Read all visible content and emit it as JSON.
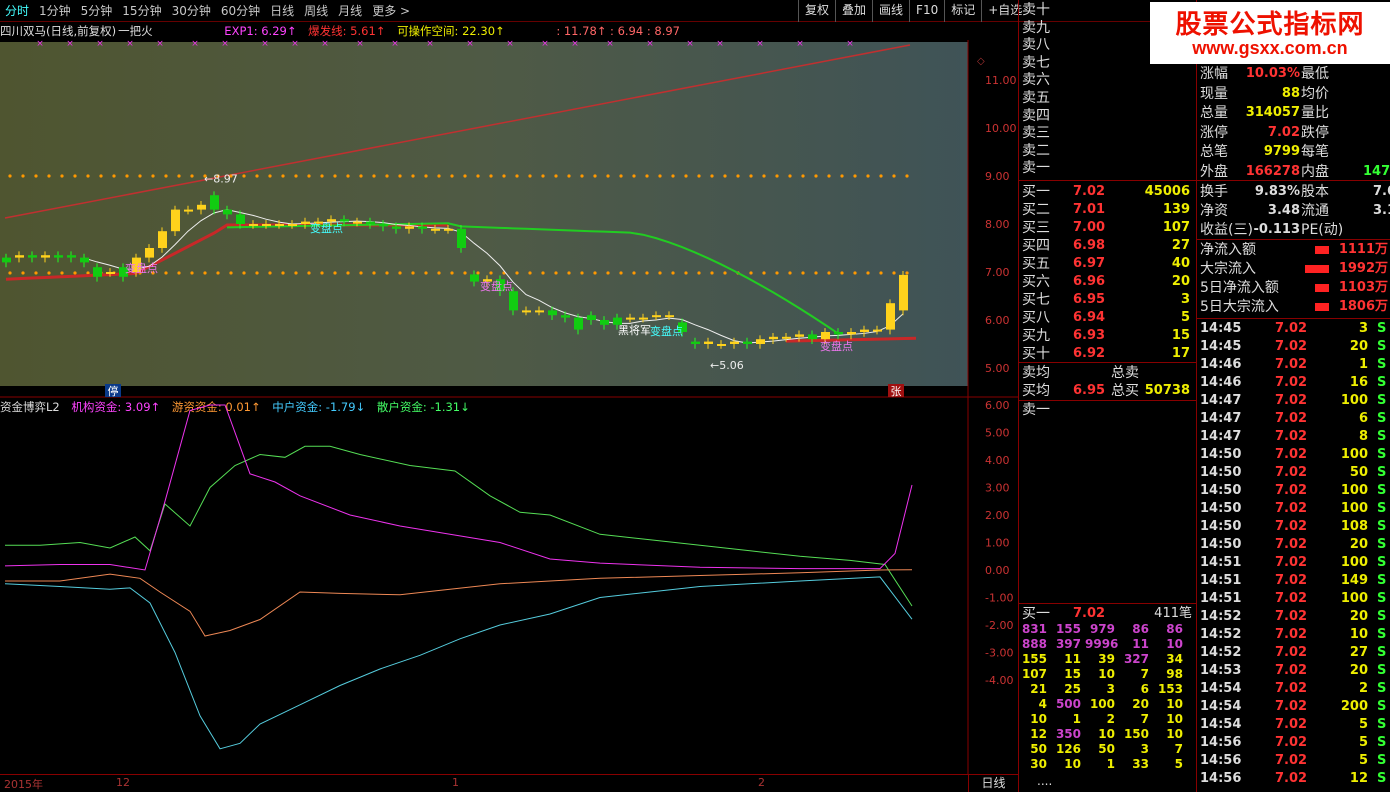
{
  "top_tabs": [
    "分时",
    "1分钟",
    "5分钟",
    "15分钟",
    "30分钟",
    "60分钟",
    "日线",
    "周线",
    "月线",
    "更多 >"
  ],
  "tool_buttons": [
    "复权",
    "叠加",
    "画线",
    "F10",
    "标记",
    "+自选"
  ],
  "watermark": {
    "line1": "股票公式指标网",
    "line2": "www.gsxx.com.cn"
  },
  "main_chart": {
    "stock": "四川双马(日线,前复权)",
    "indicator": "一把火",
    "exp1": "EXP1: 6.29↑",
    "baofa": "爆发线: 5.61↑",
    "kecaozuo": "可操作空间: 22.30↑",
    "vals": ": 11.78↑  : 6.94 : 8.97",
    "y_labels": [
      "11.00",
      "10.00",
      "9.00",
      "8.00",
      "7.00",
      "6.00",
      "5.00"
    ],
    "annotations": {
      "high": "8.97",
      "low": "5.06",
      "labels": [
        "变盘点",
        "变盘点",
        "变盘点",
        "变盘点",
        "变盘点",
        "黑将军"
      ]
    },
    "badge_left": "停",
    "badge_right": "张"
  },
  "sub_chart": {
    "title": "资金博弈L2",
    "jigou": "机构资金: 3.09↑",
    "youzi": "游资资金: 0.01↑",
    "zhonghu": "中户资金: -1.79↓",
    "sanhu": "散户资金: -1.31↓",
    "y_labels": [
      "6.00",
      "5.00",
      "4.00",
      "3.00",
      "2.00",
      "1.00",
      "0.00",
      "-1.00",
      "-2.00",
      "-3.00",
      "-4.00"
    ]
  },
  "x_axis": {
    "labels": [
      "2015年",
      "12",
      "1",
      "2"
    ],
    "period": "日线"
  },
  "chart_data": {
    "type": "candlestick",
    "price": {
      "open": [
        7.3,
        7.3,
        7.35,
        7.3,
        7.35,
        7.35,
        7.3,
        7.1,
        7.0,
        7.1,
        7.0,
        7.3,
        7.5,
        7.85,
        8.3,
        8.3,
        8.6,
        8.3,
        8.2,
        8.0,
        8.0,
        8.0,
        8.0,
        8.0,
        8.05,
        8.05,
        8.1,
        8.05,
        8.05,
        8.0,
        7.95,
        7.9,
        7.95,
        7.9,
        7.9,
        7.9,
        6.95,
        6.8,
        6.85,
        6.6,
        6.2,
        6.2,
        6.2,
        6.1,
        6.05,
        6.1,
        6.0,
        6.05,
        6.05,
        6.05,
        6.1,
        6.1,
        5.95,
        5.55,
        5.5,
        5.5,
        5.5,
        5.55,
        5.5,
        5.6,
        5.65,
        5.65,
        5.7,
        5.6,
        5.75,
        5.7,
        5.75,
        5.8,
        5.8,
        6.2
      ],
      "close": [
        7.2,
        7.35,
        7.3,
        7.35,
        7.3,
        7.3,
        7.2,
        6.9,
        7.0,
        6.9,
        7.3,
        7.5,
        7.85,
        8.3,
        8.3,
        8.4,
        8.3,
        8.2,
        8.0,
        8.0,
        8.0,
        8.0,
        8.0,
        8.05,
        8.05,
        8.1,
        8.05,
        8.05,
        8.0,
        7.95,
        7.9,
        7.95,
        7.9,
        7.9,
        7.9,
        7.5,
        6.8,
        6.85,
        6.6,
        6.2,
        6.2,
        6.2,
        6.1,
        6.05,
        5.8,
        6.0,
        5.9,
        5.9,
        6.05,
        6.05,
        6.1,
        6.1,
        5.75,
        5.5,
        5.55,
        5.5,
        5.55,
        5.5,
        5.6,
        5.65,
        5.65,
        5.7,
        5.6,
        5.75,
        5.7,
        5.75,
        5.8,
        5.8,
        6.35,
        6.94
      ]
    },
    "fund_lines": {
      "jigou": 3.09,
      "youzi": 0.01,
      "zhonghu": -1.79,
      "sanhu": -1.31
    }
  },
  "quote": {
    "sell_levels": [
      "卖十",
      "卖九",
      "卖八",
      "卖七",
      "卖六",
      "卖五",
      "卖四",
      "卖三",
      "卖二",
      "卖一"
    ],
    "stats": [
      [
        "涨幅",
        "10.03%",
        "最低",
        ""
      ],
      [
        "现量",
        "88",
        "均价",
        ""
      ],
      [
        "总量",
        "314057",
        "量比",
        ""
      ],
      [
        "涨停",
        "7.02",
        "跌停",
        ""
      ],
      [
        "总笔",
        "9799",
        "每笔",
        ""
      ],
      [
        "外盘",
        "166278",
        "内盘",
        "147"
      ]
    ],
    "buy_levels": [
      [
        "买一",
        "7.02",
        "45006"
      ],
      [
        "买二",
        "7.01",
        "139"
      ],
      [
        "买三",
        "7.00",
        "107"
      ],
      [
        "买四",
        "6.98",
        "27"
      ],
      [
        "买五",
        "6.97",
        "40"
      ],
      [
        "买六",
        "6.96",
        "20"
      ],
      [
        "买七",
        "6.95",
        "3"
      ],
      [
        "买八",
        "6.94",
        "5"
      ],
      [
        "买九",
        "6.93",
        "15"
      ],
      [
        "买十",
        "6.92",
        "17"
      ]
    ],
    "avg": {
      "sell_avg": "卖均",
      "total_sell": "总卖",
      "buy_avg": "买均",
      "buy_avg_val": "6.95",
      "total_buy": "总买",
      "total_buy_val": "50738",
      "sell_one": "卖一"
    },
    "fin": [
      [
        "换手",
        "9.83%",
        "股本",
        "7.6"
      ],
      [
        "净资",
        "3.48",
        "流通",
        "3.1"
      ],
      [
        "收益(三)",
        "-0.113",
        "PE(动)",
        ""
      ]
    ],
    "flow": [
      [
        "净流入额",
        "1111万"
      ],
      [
        "大宗流入",
        "1992万"
      ],
      [
        "5日净流入额",
        "1103万"
      ],
      [
        "5日大宗流入",
        "1806万"
      ]
    ],
    "queue_header": {
      "label": "买一",
      "price": "7.02",
      "count": "411笔"
    },
    "queue": [
      [
        "831",
        "155",
        "979",
        "86",
        "86"
      ],
      [
        "888",
        "397",
        "9996",
        "11",
        "10"
      ],
      [
        "155",
        "11",
        "39",
        "327",
        "34"
      ],
      [
        "107",
        "15",
        "10",
        "7",
        "98"
      ],
      [
        "21",
        "25",
        "3",
        "6",
        "153"
      ],
      [
        "4",
        "500",
        "100",
        "20",
        "10"
      ],
      [
        "10",
        "1",
        "2",
        "7",
        "10"
      ],
      [
        "12",
        "350",
        "10",
        "150",
        "10"
      ],
      [
        "50",
        "126",
        "50",
        "3",
        "7"
      ],
      [
        "30",
        "10",
        "1",
        "33",
        "5"
      ]
    ],
    "queue_more": "....",
    "ticks": [
      [
        "14:45",
        "7.02",
        "3",
        "S"
      ],
      [
        "14:45",
        "7.02",
        "20",
        "S"
      ],
      [
        "14:46",
        "7.02",
        "1",
        "S"
      ],
      [
        "14:46",
        "7.02",
        "16",
        "S"
      ],
      [
        "14:47",
        "7.02",
        "100",
        "S"
      ],
      [
        "14:47",
        "7.02",
        "6",
        "S"
      ],
      [
        "14:47",
        "7.02",
        "8",
        "S"
      ],
      [
        "14:50",
        "7.02",
        "100",
        "S"
      ],
      [
        "14:50",
        "7.02",
        "50",
        "S"
      ],
      [
        "14:50",
        "7.02",
        "100",
        "S"
      ],
      [
        "14:50",
        "7.02",
        "100",
        "S"
      ],
      [
        "14:50",
        "7.02",
        "108",
        "S"
      ],
      [
        "14:50",
        "7.02",
        "20",
        "S"
      ],
      [
        "14:51",
        "7.02",
        "100",
        "S"
      ],
      [
        "14:51",
        "7.02",
        "149",
        "S"
      ],
      [
        "14:51",
        "7.02",
        "100",
        "S"
      ],
      [
        "14:52",
        "7.02",
        "20",
        "S"
      ],
      [
        "14:52",
        "7.02",
        "10",
        "S"
      ],
      [
        "14:52",
        "7.02",
        "27",
        "S"
      ],
      [
        "14:53",
        "7.02",
        "20",
        "S"
      ],
      [
        "14:54",
        "7.02",
        "2",
        "S"
      ],
      [
        "14:54",
        "7.02",
        "200",
        "S"
      ],
      [
        "14:54",
        "7.02",
        "5",
        "S"
      ],
      [
        "14:56",
        "7.02",
        "5",
        "S"
      ],
      [
        "14:56",
        "7.02",
        "5",
        "S"
      ],
      [
        "14:56",
        "7.02",
        "12",
        "S"
      ]
    ]
  }
}
